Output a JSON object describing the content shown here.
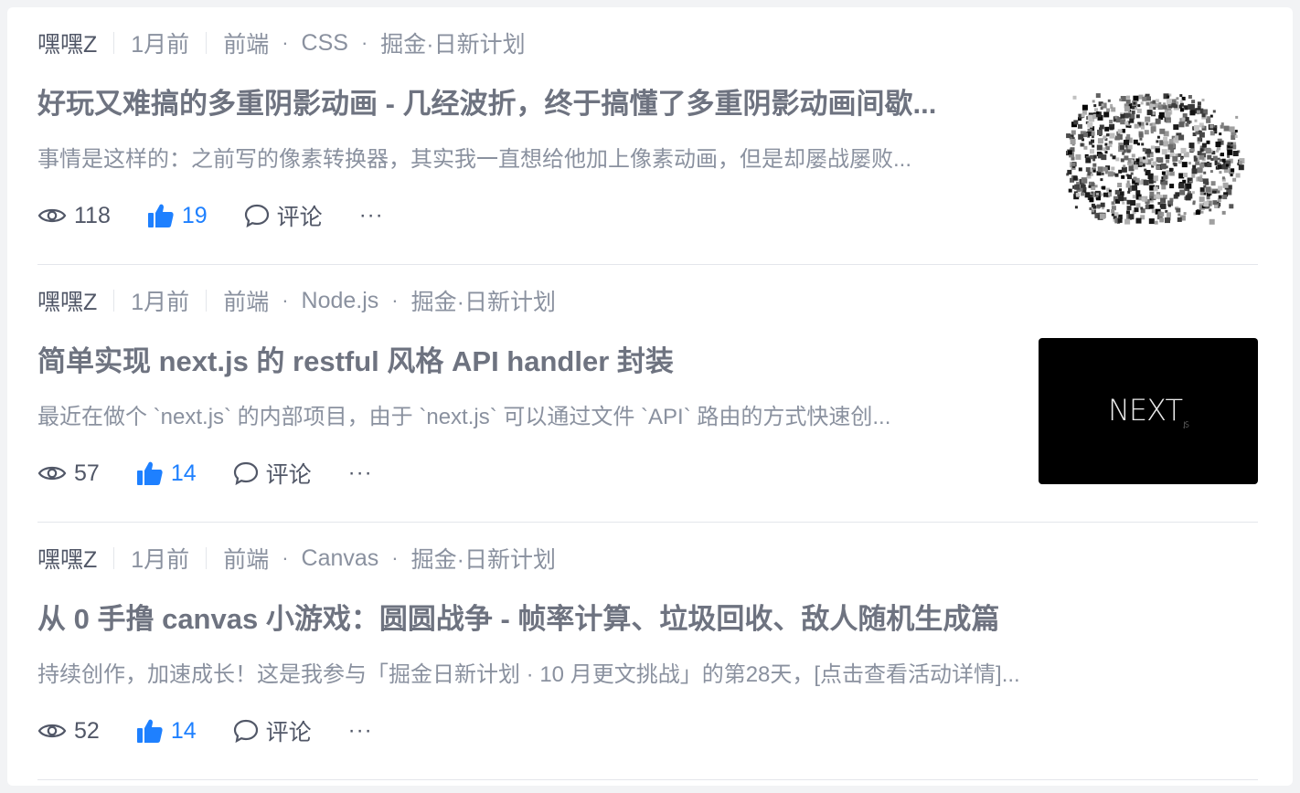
{
  "articles": [
    {
      "author": "嘿嘿Z",
      "time": "1月前",
      "tags": [
        "前端",
        "CSS",
        "掘金·日新计划"
      ],
      "title": "好玩又难搞的多重阴影动画 - 几经波折，终于搞懂了多重阴影动画间歇...",
      "abstract": "事情是这样的：之前写的像素转换器，其实我一直想给他加上像素动画，但是却屡战屡败...",
      "views": "118",
      "likes": "19",
      "comment_label": "评论",
      "more": "···",
      "liked": true,
      "thumbnail": "pixel-noise"
    },
    {
      "author": "嘿嘿Z",
      "time": "1月前",
      "tags": [
        "前端",
        "Node.js",
        "掘金·日新计划"
      ],
      "title": "简单实现 next.js 的 restful 风格 API handler 封装",
      "abstract": "最近在做个 `next.js` 的内部项目，由于 `next.js` 可以通过文件 `API` 路由的方式快速创...",
      "views": "57",
      "likes": "14",
      "comment_label": "评论",
      "more": "···",
      "liked": true,
      "thumbnail": "nextjs-logo",
      "thumb_text": "NEXT",
      "thumb_sub": ".JS"
    },
    {
      "author": "嘿嘿Z",
      "time": "1月前",
      "tags": [
        "前端",
        "Canvas",
        "掘金·日新计划"
      ],
      "title": "从 0 手撸 canvas 小游戏：圆圆战争 - 帧率计算、垃圾回收、敌人随机生成篇",
      "abstract": "持续创作，加速成长！这是我参与「掘金日新计划 · 10 月更文挑战」的第28天，[点击查看活动详情]...",
      "views": "52",
      "likes": "14",
      "comment_label": "评论",
      "more": "···",
      "liked": true
    }
  ],
  "colors": {
    "accent": "#1e80ff",
    "title": "#6e7380",
    "muted": "#8a919f",
    "divider": "#e4e6eb"
  }
}
